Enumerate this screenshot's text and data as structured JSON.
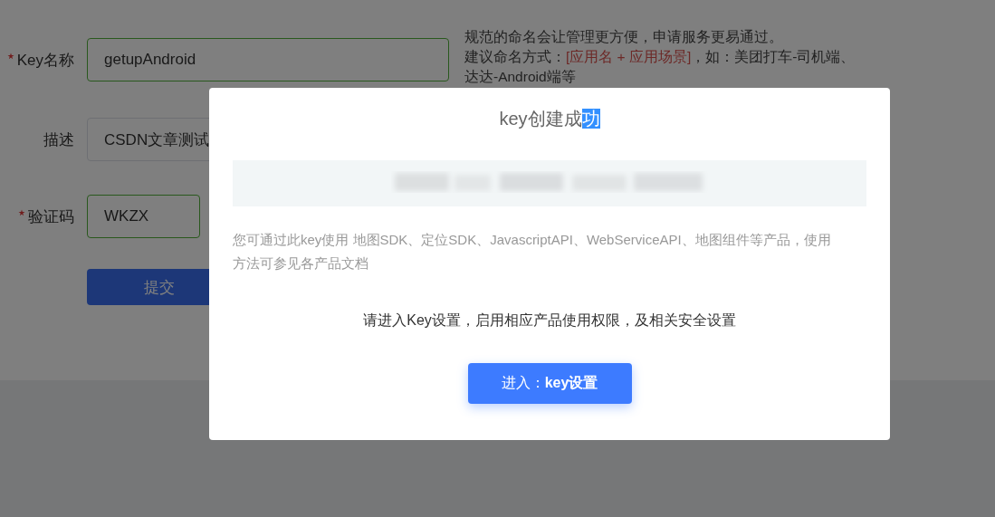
{
  "form": {
    "fields": [
      {
        "label": "Key名称",
        "required": true,
        "value": "getupAndroid",
        "valid": true,
        "kind": "text"
      },
      {
        "label": "描述",
        "required": false,
        "value": "CSDN文章测试",
        "valid": false,
        "kind": "text"
      },
      {
        "label": "验证码",
        "required": true,
        "value": "WKZX",
        "valid": true,
        "kind": "captcha"
      }
    ],
    "hint": {
      "line": "规范的命名会让管理更方便，申请服务更易通过。",
      "parts": [
        {
          "text": "建议命名方式：",
          "kind": "plain"
        },
        {
          "text": "[应用名 + 应用场景]",
          "kind": "highlight"
        },
        {
          "text": "，如：美团打车-司机端、达达-Android端等",
          "kind": "plain"
        }
      ]
    },
    "submit": "提交"
  },
  "modal": {
    "title": [
      {
        "text": "key创建成",
        "selected": false
      },
      {
        "text": "功",
        "selected": true
      }
    ],
    "description": "您可通过此key使用 地图SDK、定位SDK、JavascriptAPI、WebServiceAPI、地图组件等产品，使用方法可参见各产品文档",
    "instruction": "请进入Key设置，启用相应产品使用权限，及相关安全设置",
    "button": "进入：**key设置**"
  }
}
